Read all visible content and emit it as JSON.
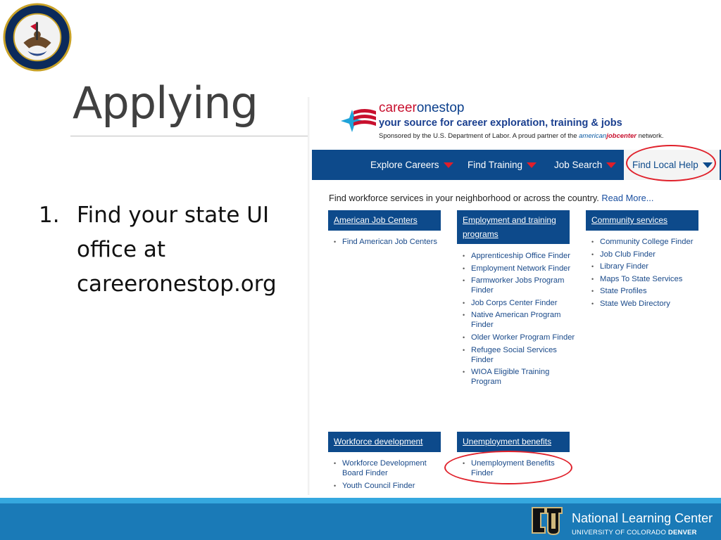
{
  "slide": {
    "title": "Applying",
    "bullet_number": "1.",
    "bullet_text": "Find your state UI office at careeronestop.org"
  },
  "site": {
    "logo_name_part1": "career",
    "logo_name_part2": "onestop",
    "tagline": "your source for career exploration, training & jobs",
    "sponsor_text": "Sponsored by the U.S. Department of Labor. A proud partner of the ",
    "sponsor_partner_a": "american",
    "sponsor_partner_b": "jobcenter",
    "sponsor_suffix": " network.",
    "nav": [
      {
        "label": "Explore Careers"
      },
      {
        "label": "Find Training"
      },
      {
        "label": "Job Search"
      },
      {
        "label": "Find Local Help"
      }
    ],
    "intro": "Find workforce services in your neighborhood or across the country.",
    "read_more": "Read More...",
    "categories": {
      "american_job_centers": {
        "title": "American Job Centers",
        "links": [
          "Find American Job Centers"
        ]
      },
      "employment_training": {
        "title": "Employment and training programs",
        "links": [
          "Apprenticeship Office Finder",
          "Employment Network Finder",
          "Farmworker Jobs Program Finder",
          "Job Corps Center Finder",
          "Native American Program Finder",
          "Older Worker Program Finder",
          "Refugee Social Services Finder",
          "WIOA Eligible Training Program"
        ]
      },
      "community_services": {
        "title": "Community services",
        "links": [
          "Community College Finder",
          "Job Club Finder",
          "Library Finder",
          "Maps To State Services",
          "State Profiles",
          "State Web Directory"
        ]
      },
      "workforce_development": {
        "title": "Workforce development",
        "links": [
          "Workforce Development Board Finder",
          "Youth Council Finder"
        ]
      },
      "unemployment_benefits": {
        "title": "Unemployment benefits",
        "links": [
          "Unemployment Benefits Finder"
        ]
      }
    }
  },
  "footer": {
    "org_name": "National Learning Center",
    "org_sub_a": "UNIVERSITY OF COLORADO ",
    "org_sub_b": "DENVER"
  },
  "colors": {
    "nav_blue": "#0d4a8b",
    "highlight_red": "#e0212b",
    "footer_blue": "#1a7ab7",
    "footer_stripe": "#35a8df"
  }
}
